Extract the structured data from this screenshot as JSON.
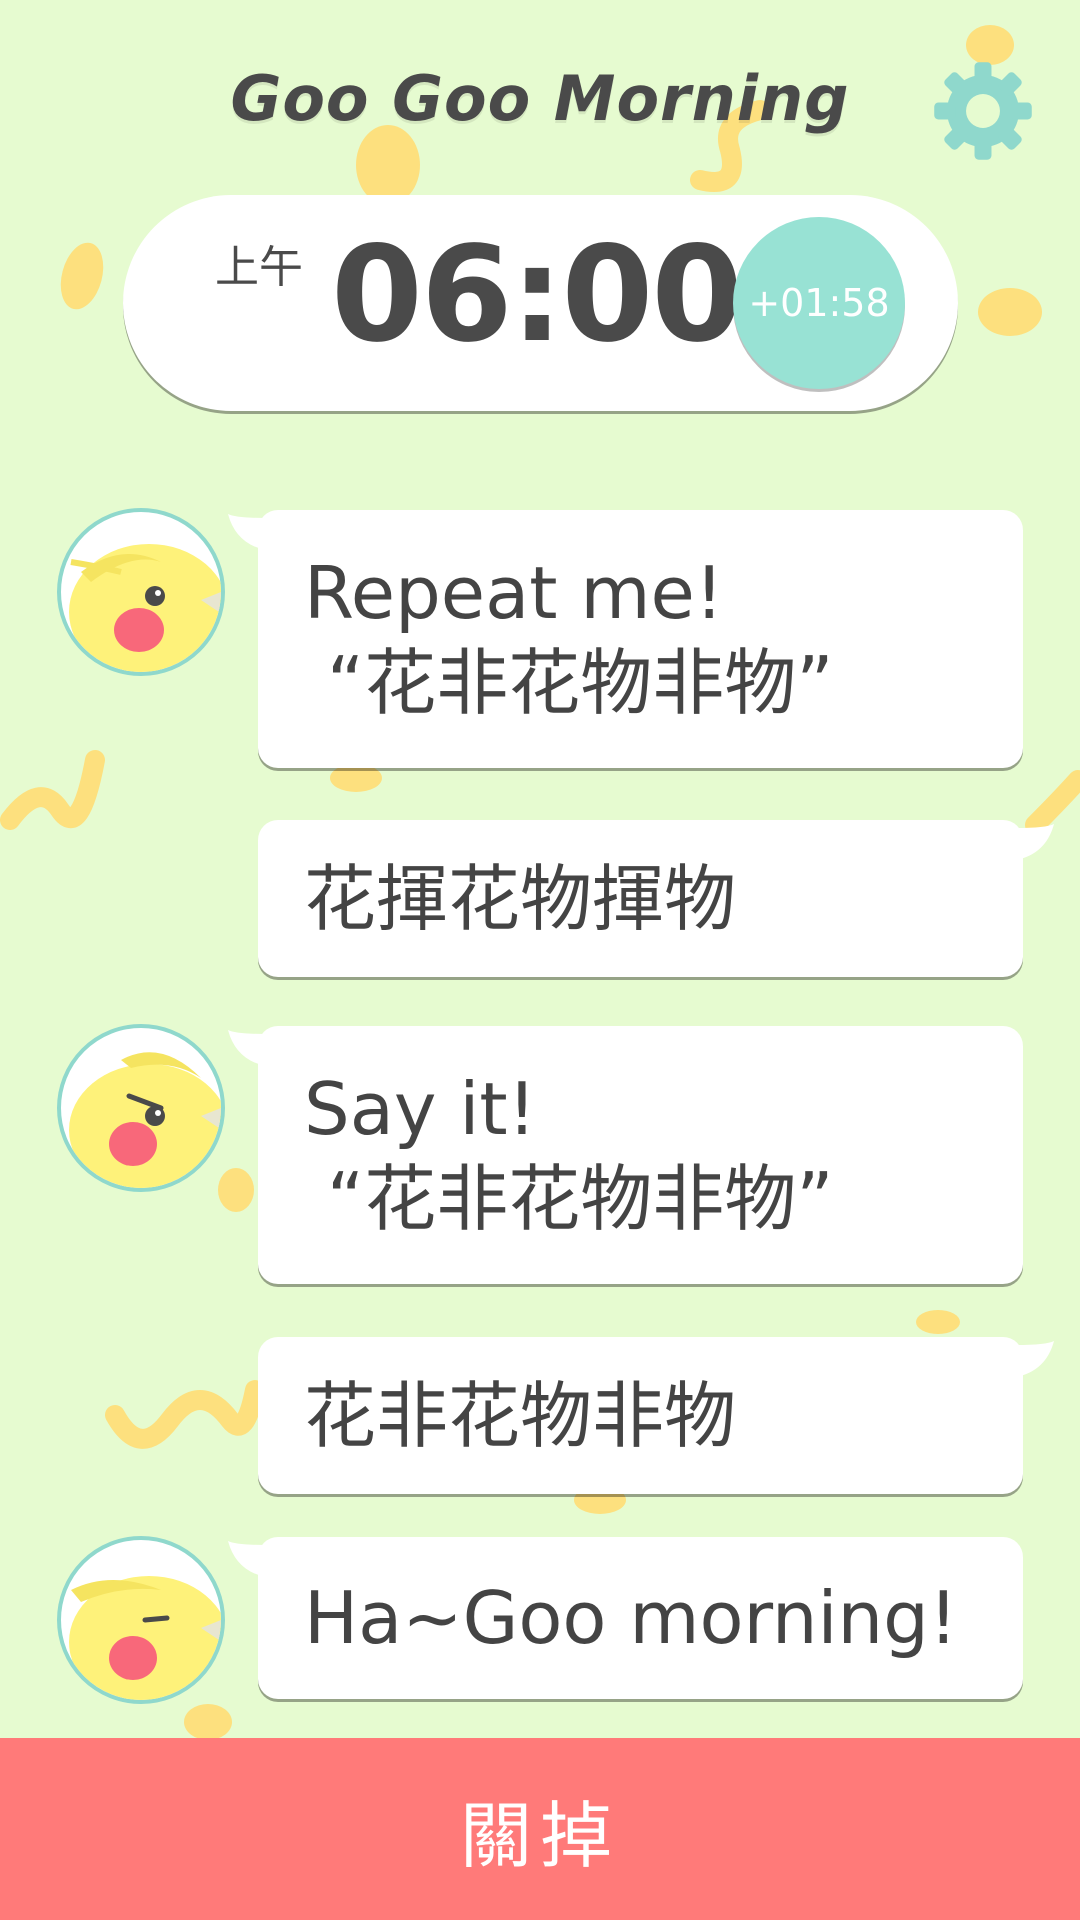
{
  "header": {
    "title": "Goo Goo Morning",
    "settings_icon": "gear-icon"
  },
  "alarm": {
    "period": "上午",
    "time": "06:00",
    "snooze_offset": "+01:58"
  },
  "chat": [
    {
      "speaker": "bird",
      "avatar_icon": "bird-avatar-icon",
      "line1": "Repeat me!",
      "line2": " “花非花物非物”"
    },
    {
      "speaker": "user",
      "line1": "花揮花物揮物"
    },
    {
      "speaker": "bird",
      "avatar_icon": "angry-bird-avatar-icon",
      "line1": "Say it!",
      "line2": " “花非花物非物”"
    },
    {
      "speaker": "user",
      "line1": "花非花物非物"
    },
    {
      "speaker": "bird",
      "avatar_icon": "happy-bird-avatar-icon",
      "line1": "Ha~Goo morning!"
    }
  ],
  "footer": {
    "dismiss_label": "關掉"
  },
  "colors": {
    "background": "#e6fbd0",
    "accent": "#98e2d4",
    "dismiss": "#ff7a79",
    "deco": "#fde07e"
  }
}
